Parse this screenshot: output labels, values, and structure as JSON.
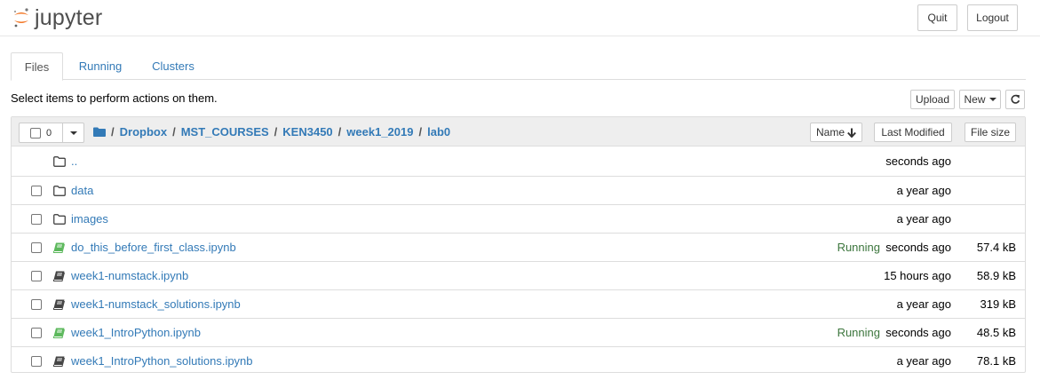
{
  "header": {
    "logo_text": "jupyter",
    "quit_label": "Quit",
    "logout_label": "Logout"
  },
  "tabs": [
    {
      "label": "Files",
      "active": true
    },
    {
      "label": "Running",
      "active": false
    },
    {
      "label": "Clusters",
      "active": false
    }
  ],
  "toolbar": {
    "hint": "Select items to perform actions on them.",
    "upload_label": "Upload",
    "new_label": "New",
    "refresh_icon": "refresh-icon"
  },
  "list_header": {
    "selected_count": "0",
    "breadcrumb": [
      "Dropbox",
      "MST_COURSES",
      "KEN3450",
      "week1_2019",
      "lab0"
    ],
    "sort_name_label": "Name",
    "sort_modified_label": "Last Modified",
    "sort_size_label": "File size"
  },
  "colors": {
    "link": "#337ab7",
    "running": "#3c763d",
    "running_notebook_icon": "#5cb85c",
    "logo_orange": "#f37726"
  },
  "files": [
    {
      "name": "..",
      "type": "parent",
      "status": "",
      "modified": "seconds ago",
      "size": ""
    },
    {
      "name": "data",
      "type": "folder",
      "status": "",
      "modified": "a year ago",
      "size": ""
    },
    {
      "name": "images",
      "type": "folder",
      "status": "",
      "modified": "a year ago",
      "size": ""
    },
    {
      "name": "do_this_before_first_class.ipynb",
      "type": "notebook",
      "status": "Running",
      "modified": "seconds ago",
      "size": "57.4 kB"
    },
    {
      "name": "week1-numstack.ipynb",
      "type": "notebook",
      "status": "",
      "modified": "15 hours ago",
      "size": "58.9 kB"
    },
    {
      "name": "week1-numstack_solutions.ipynb",
      "type": "notebook",
      "status": "",
      "modified": "a year ago",
      "size": "319 kB"
    },
    {
      "name": "week1_IntroPython.ipynb",
      "type": "notebook",
      "status": "Running",
      "modified": "seconds ago",
      "size": "48.5 kB"
    },
    {
      "name": "week1_IntroPython_solutions.ipynb",
      "type": "notebook",
      "status": "",
      "modified": "a year ago",
      "size": "78.1 kB"
    }
  ]
}
